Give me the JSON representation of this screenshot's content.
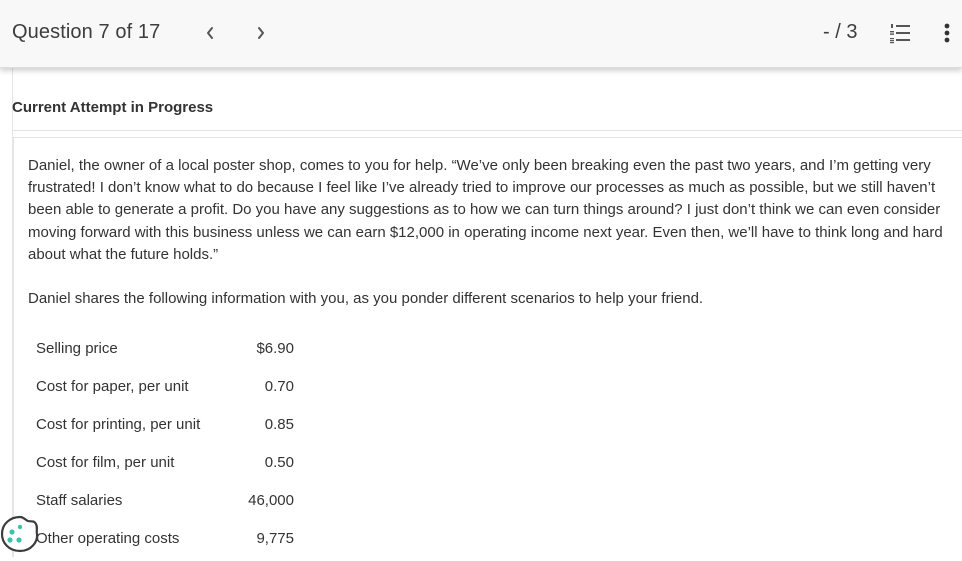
{
  "header": {
    "question_label": "Question 7 of 17",
    "prev_glyph": "<",
    "next_glyph": ">",
    "score": "- / 3",
    "accent": "#5a5a5a"
  },
  "attempt": {
    "title": "Current Attempt in Progress"
  },
  "question": {
    "paragraph_1": "Daniel, the owner of a local poster shop, comes to you for help. “We’ve only been breaking even the past two years, and I’m getting very frustrated! I don’t know what to do because I feel like I’ve already tried to improve our processes as much as possible, but we still haven’t been able to generate a profit. Do you have any suggestions as to how we can turn things around? I just don’t think we can even consider moving forward with this business unless we can earn $12,000 in operating income next year. Even then, we’ll have to think long and hard about what the future holds.”",
    "paragraph_2": "Daniel shares the following information with you, as you ponder different scenarios to help your friend."
  },
  "table": {
    "rows": [
      {
        "label": "Selling price",
        "value": "$6.90"
      },
      {
        "label": "Cost for paper, per unit",
        "value": "0.70"
      },
      {
        "label": "Cost for printing, per unit",
        "value": "0.85"
      },
      {
        "label": "Cost for film, per unit",
        "value": "0.50"
      },
      {
        "label": "Staff salaries",
        "value": "46,000"
      },
      {
        "label": "Other operating costs",
        "value": "9,775"
      }
    ]
  },
  "icons": {
    "prev": "chevron-left-icon",
    "next": "chevron-right-icon",
    "list": "numbered-list-icon",
    "more": "more-vertical-icon",
    "cookie": "cookie-settings-icon"
  },
  "colors": {
    "cookie_dots": "#3fc1a5"
  }
}
